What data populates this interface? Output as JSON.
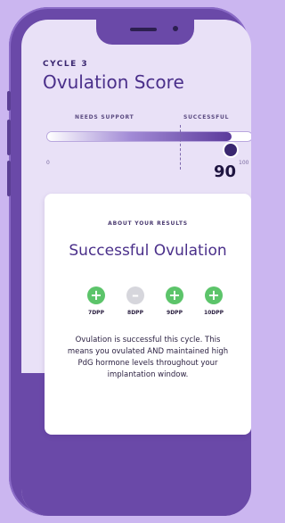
{
  "header": {
    "cycle_label": "CYCLE 3",
    "title": "Ovulation Score"
  },
  "score_scale": {
    "low_label": "NEEDS SUPPORT",
    "high_label": "SUCCESSFUL",
    "min_label": "0",
    "max_label": "100",
    "value": 90,
    "value_label": "90",
    "threshold": 70
  },
  "results_card": {
    "eyebrow": "ABOUT YOUR RESULTS",
    "title": "Successful Ovulation",
    "days": [
      {
        "label": "7DPP",
        "status": "positive",
        "icon": "plus-circle-icon"
      },
      {
        "label": "8DPP",
        "status": "neutral",
        "icon": "minus-circle-icon"
      },
      {
        "label": "9DPP",
        "status": "positive",
        "icon": "plus-circle-icon"
      },
      {
        "label": "10DPP",
        "status": "positive",
        "icon": "plus-circle-icon"
      }
    ],
    "body": "Ovulation is successful this cycle. This means you ovulated AND maintained high PdG hormone levels throughout your implantation window."
  },
  "colors": {
    "accent": "#4a2f8a",
    "positive": "#5cc46a",
    "neutral": "#d6d6dc",
    "phone": "#6a49a8"
  }
}
